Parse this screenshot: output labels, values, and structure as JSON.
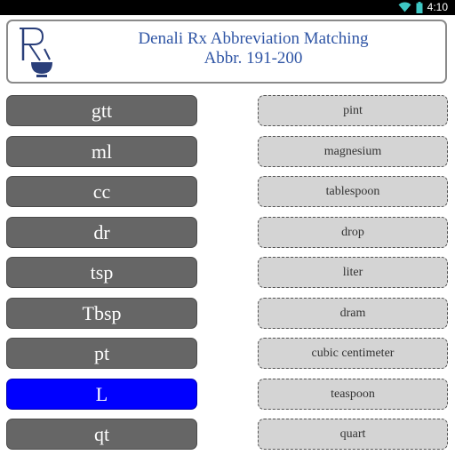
{
  "status_bar": {
    "time": "4:10",
    "icons": [
      "wifi-icon",
      "battery-icon"
    ],
    "background": "#000000"
  },
  "header": {
    "logo": "rx-mortar-pestle-logo",
    "title": "Denali Rx Abbreviation Matching",
    "subtitle": "Abbr. 191-200",
    "title_color": "#2f55a5"
  },
  "abbreviations": [
    {
      "label": "gtt",
      "selected": false
    },
    {
      "label": "ml",
      "selected": false
    },
    {
      "label": "cc",
      "selected": false
    },
    {
      "label": "dr",
      "selected": false
    },
    {
      "label": "tsp",
      "selected": false
    },
    {
      "label": "Tbsp",
      "selected": false
    },
    {
      "label": "pt",
      "selected": false
    },
    {
      "label": "L",
      "selected": true
    },
    {
      "label": "qt",
      "selected": false
    }
  ],
  "definitions": [
    "pint",
    "magnesium",
    "tablespoon",
    "drop",
    "liter",
    "dram",
    "cubic centimeter",
    "teaspoon",
    "quart"
  ],
  "colors": {
    "abbr_button": "#666666",
    "abbr_selected": "#0000ff",
    "definition_box": "#d4d4d4",
    "definition_border": "#555555"
  }
}
